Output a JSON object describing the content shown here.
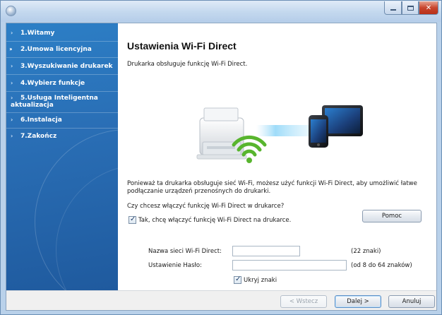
{
  "window": {
    "title": ""
  },
  "sidebar": {
    "items": [
      {
        "label": "1.Witamy",
        "active": false
      },
      {
        "label": "2.Umowa licencyjna",
        "active": true
      },
      {
        "label": "3.Wyszukiwanie drukarek",
        "active": false
      },
      {
        "label": "4.Wybierz funkcje",
        "active": false
      },
      {
        "label": "5.Usługa Inteligentna",
        "label2": "aktualizacja",
        "active": false
      },
      {
        "label": "6.Instalacja",
        "active": false
      },
      {
        "label": "7.Zakończ",
        "active": false
      }
    ]
  },
  "main": {
    "title": "Ustawienia Wi-Fi Direct",
    "support_text": "Drukarka obsługuje funkcję Wi-Fi Direct.",
    "description_line1": "Ponieważ ta drukarka obsługuje sieć Wi-Fi, możesz użyć funkcji Wi-Fi Direct, aby umożliwić łatwe",
    "description_line2": "podłączanie urządzeń przenośnych do drukarki.",
    "question": "Czy chcesz włączyć funkcję Wi-Fi Direct w drukarce?",
    "enable_checkbox": {
      "label": "Tak, chcę włączyć funkcję Wi-Fi Direct na drukarce.",
      "checked": true
    },
    "help_button": "Pomoc",
    "network_name": {
      "label": "Nazwa sieci Wi-Fi Direct:",
      "value": "",
      "hint": "(22 znaki)"
    },
    "password": {
      "label": "Ustawienie Hasło:",
      "value": "",
      "hint": "(od 8 do 64 znaków)"
    },
    "hide_chars": {
      "label": "Ukryj znaki",
      "checked": true
    }
  },
  "footer": {
    "back": "< Wstecz",
    "next": "Dalej >",
    "cancel": "Anuluj"
  },
  "colors": {
    "sidebar": "#2a6fb6",
    "wifi": "#58b52e",
    "close": "#c8452d"
  },
  "icons": [
    "app-icon",
    "minimize-icon",
    "maximize-icon",
    "close-icon",
    "printer-icon",
    "wifi-icon",
    "phone-icon",
    "tablet-icon"
  ]
}
